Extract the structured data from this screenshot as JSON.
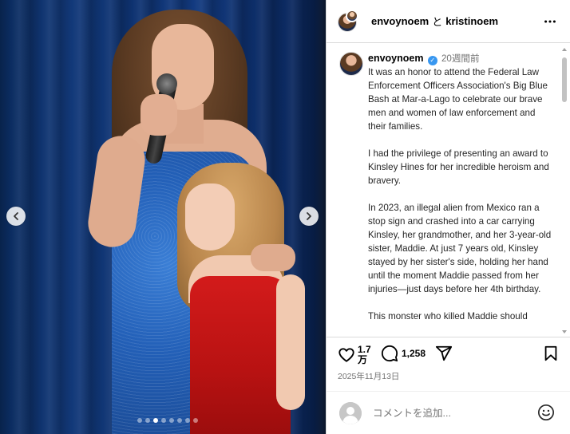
{
  "media": {
    "slide_count": 8,
    "active_slide": 2,
    "prev_icon": "chevron-left-icon",
    "next_icon": "chevron-right-icon"
  },
  "header": {
    "user1": "envoynoem",
    "separator": "と",
    "user2": "kristinoem",
    "more_icon": "more-horizontal-icon"
  },
  "post": {
    "username": "envoynoem",
    "time_ago": "20週間前",
    "caption_paragraphs": [
      "It was an honor to attend the Federal Law Enforcement Officers Association's Big Blue Bash at Mar-a-Lago to celebrate our brave men and women of law enforcement and their families.",
      "I had the privilege of presenting an award to Kinsley Hines for her incredible heroism and bravery.",
      "In 2023, an illegal alien from Mexico ran a stop sign and crashed into a car carrying Kinsley, her grandmother, and her 3-year-old sister, Maddie. At just 7 years old, Kinsley stayed by her sister's side, holding her hand until the moment Maddie passed from her injuries—just days before her 4th birthday.",
      "This monster who killed Maddie should"
    ]
  },
  "actions": {
    "like_count_line1": "1.7",
    "like_count_line2": "万",
    "comment_count": "1,258",
    "date": "2025年11月13日"
  },
  "comment_box": {
    "placeholder": "コメントを追加..."
  },
  "colors": {
    "verified": "#3897f0",
    "border": "#dbdbdb",
    "muted": "#737373"
  }
}
